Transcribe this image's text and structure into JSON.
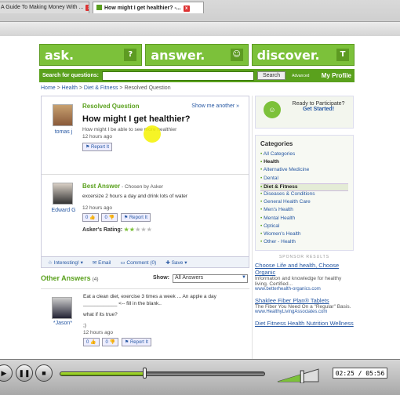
{
  "browser": {
    "tabs": [
      {
        "label": "A Guide To Making Money With ...",
        "active": false
      },
      {
        "label": "How might I get healthier? -...",
        "active": true
      }
    ]
  },
  "header": {
    "sections": [
      {
        "label": "ask.",
        "icon": "question-icon",
        "glyph": "?"
      },
      {
        "label": "answer.",
        "icon": "smiley-icon",
        "glyph": "☺"
      },
      {
        "label": "discover.",
        "icon": "lightbulb-icon",
        "glyph": "T"
      }
    ]
  },
  "search": {
    "label": "Search for questions:",
    "value": "",
    "button": "Search",
    "advanced": "Advanced",
    "profile": "My Profile"
  },
  "breadcrumb": {
    "home": "Home",
    "sep1": " > ",
    "health": "Health",
    "sep2": " > ",
    "diet": "Diet & Fitness",
    "sep3": " > ",
    "current": "Resolved Question"
  },
  "question": {
    "status": "Resolved Question",
    "show_more": "Show me another »",
    "user": "tomas j",
    "title": "How might I get healthier?",
    "details": "How might I be able to see more healthier",
    "time": "12 hours ago",
    "report": "Report It"
  },
  "best_answer": {
    "heading": "Best Answer",
    "chosen": " - Chosen by Asker",
    "user": "Edward G",
    "text": "excersize 2 hours a day and drink lots of water",
    "time": "12 hours ago",
    "up": "0",
    "down": "0",
    "report": "Report It",
    "rating_label": "Asker's Rating:",
    "rating": 2,
    "rating_max": 5
  },
  "actions": {
    "interesting": "Interesting!",
    "email": "Email",
    "comment": "Comment (0)",
    "save": "Save"
  },
  "other_answers": {
    "title": "Other Answers",
    "count": "(4)",
    "show_label": "Show:",
    "show_value": "All Answers",
    "answers": [
      {
        "user": "*Jason*",
        "line1": "Eat a clean diet, exercise 3 times a week ... An apple a day",
        "line2": "____________ <-- fill in the blank..",
        "line3": "what if its true?",
        "line4": ";)",
        "time": "12 hours ago",
        "up": "0",
        "down": "0",
        "report": "Report It"
      }
    ]
  },
  "sidebar": {
    "participate": {
      "line1": "Ready to Participate?",
      "link": "Get Started!"
    },
    "categories_title": "Categories",
    "categories": [
      {
        "label": "All Categories",
        "style": ""
      },
      {
        "label": "Health",
        "style": "bold"
      },
      {
        "label": "Alternative Medicine",
        "style": ""
      },
      {
        "label": "Dental",
        "style": ""
      },
      {
        "label": "Diet & Fitness",
        "style": "hl"
      },
      {
        "label": "Diseases & Conditions",
        "style": ""
      },
      {
        "label": "General Health Care",
        "style": ""
      },
      {
        "label": "Men's Health",
        "style": ""
      },
      {
        "label": "Mental Health",
        "style": ""
      },
      {
        "label": "Optical",
        "style": ""
      },
      {
        "label": "Women's Health",
        "style": ""
      },
      {
        "label": "Other - Health",
        "style": ""
      }
    ],
    "sponsor_label": "SPONSOR RESULTS",
    "ads": [
      {
        "title": "Choose Life and health, Choose Organic",
        "text": "Information and knowledge for healthy living. Certified...",
        "url": "www.betterhealth-organics.com"
      },
      {
        "title": "Shaklee Fiber Plan® Tablets",
        "text": "The Fiber You Need On a \"Regular\" Basis.",
        "url": "www.HealthyLivingAssociates.com"
      },
      {
        "title": "Diet Fitness Health Nutrition Wellness",
        "text": "",
        "url": ""
      }
    ]
  },
  "player": {
    "time": "02:25 / 05:56",
    "progress": 0.41,
    "volume": 0.6
  }
}
